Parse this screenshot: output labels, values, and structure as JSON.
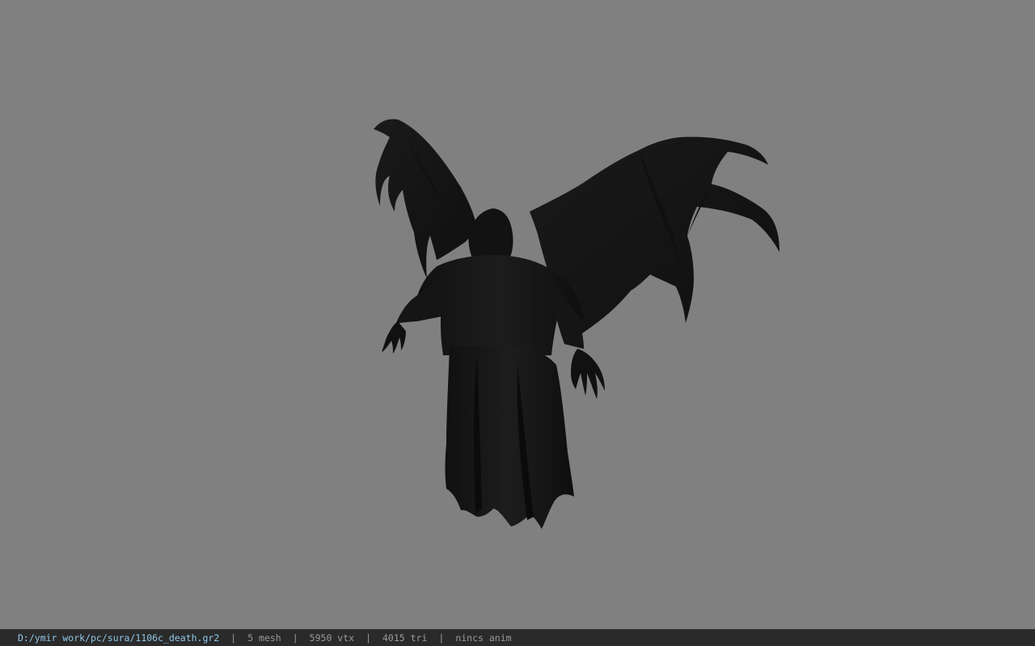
{
  "viewer": {
    "background_color": "#808080",
    "model_color": "#141414"
  },
  "statusbar": {
    "file_path": "D:/ymir work/pc/sura/1106c_death.gr2",
    "separator": "|",
    "mesh_count": "5 mesh",
    "vertex_count": "5950 vtx",
    "triangle_count": "4015 tri",
    "anim_status": "nincs anim",
    "path_color": "#8fc8e8",
    "text_color": "#9a9a9a"
  }
}
